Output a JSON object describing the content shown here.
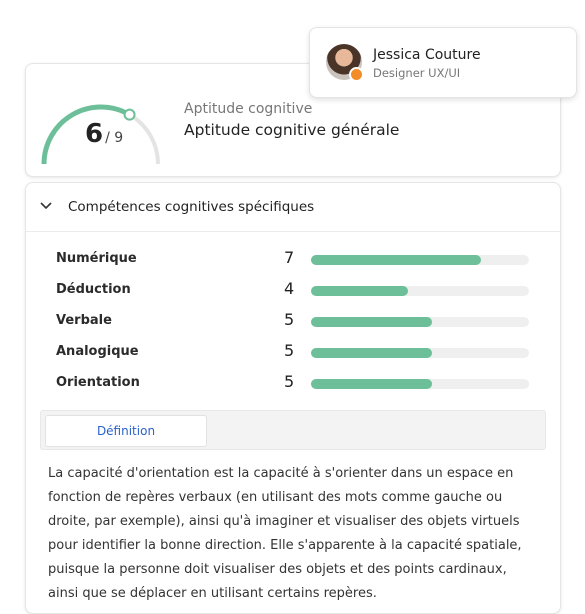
{
  "profile": {
    "name": "Jessica Couture",
    "role": "Designer UX/UI",
    "status_color": "#f28c28"
  },
  "aptitude": {
    "score": "6",
    "max": "/ 9",
    "score_fraction": 0.667,
    "label": "Aptitude cognitive",
    "title": "Aptitude cognitive générale"
  },
  "section": {
    "title": "Compétences cognitives spécifiques",
    "expanded": true
  },
  "skills": [
    {
      "label": "Numérique",
      "value": "7",
      "fraction": 0.78
    },
    {
      "label": "Déduction",
      "value": "4",
      "fraction": 0.445
    },
    {
      "label": "Verbale",
      "value": "5",
      "fraction": 0.556
    },
    {
      "label": "Analogique",
      "value": "5",
      "fraction": 0.556
    },
    {
      "label": "Orientation",
      "value": "5",
      "fraction": 0.556
    }
  ],
  "tabs": {
    "active": "Définition"
  },
  "definition": "La capacité d'orientation est la capacité à s'orienter dans un espace en fonction de repères verbaux (en utilisant des mots comme gauche ou droite, par exemple), ainsi qu'à imaginer et visualiser des objets virtuels pour identifier la bonne direction. Elle s'apparente à la capacité spatiale, puisque la personne doit visualiser des objets et des points cardinaux, ainsi que se déplacer en utilisant certains repères.",
  "colors": {
    "accent_green": "#6cbf98",
    "link_blue": "#2a62c9"
  }
}
